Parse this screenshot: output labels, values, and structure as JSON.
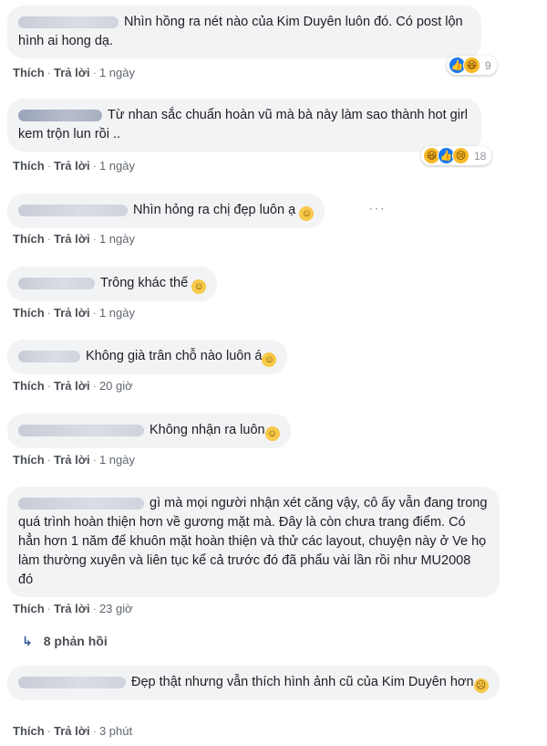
{
  "comments": [
    {
      "text": "Nhìn hồng ra nét nào của Kim Duyên luôn đó. Có post lộn hình ai hong dạ.",
      "like": "Thích",
      "reply": "Trả lời",
      "time": "1 ngày",
      "reactions": "9"
    },
    {
      "name": "Khanh Bui",
      "text": "Từ nhan sắc chuẩn hoàn vũ mà bà này làm sao thành hot girl kem trộn lun rồi ..",
      "like": "Thích",
      "reply": "Trả lời",
      "time": "1 ngày",
      "reactions": "18"
    },
    {
      "text": "Nhìn hỏng ra chị đẹp luôn ạ",
      "like": "Thích",
      "reply": "Trả lời",
      "time": "1 ngày"
    },
    {
      "text": "Trông khác thế",
      "like": "Thích",
      "reply": "Trả lời",
      "time": "1 ngày"
    },
    {
      "text": "Không già trân chỗ nào luôn á",
      "like": "Thích",
      "reply": "Trả lời",
      "time": "20 giờ"
    },
    {
      "text": "Không nhận ra luôn",
      "like": "Thích",
      "reply": "Trả lời",
      "time": "1 ngày"
    },
    {
      "text": "gì mà mọi người nhận xét căng vậy, cô ấy vẫn đang trong quá trình hoàn thiện hơn về gương mặt mà. Đây là còn chưa trang điểm. Có hẳn hơn 1 năm để khuôn mặt hoàn thiện và thử các layout, chuyện này ở Ve họ làm thường xuyên và liên tục kể cả trước đó đã phẩu vài lần rồi như MU2008 đó",
      "like": "Thích",
      "reply": "Trả lời",
      "time": "23 giờ"
    },
    {
      "text": "Đẹp thật nhưng vẫn thích hình ảnh cũ của Kim Duyên hơn",
      "like": "Thích",
      "reply": "Trả lời",
      "time": "3 phút"
    }
  ],
  "replies_label": "8 phản hồi",
  "colors": {
    "bubble": "#f2f3f5",
    "link": "#4b4f56",
    "meta": "#606770",
    "like_blue": "#1877f2"
  }
}
